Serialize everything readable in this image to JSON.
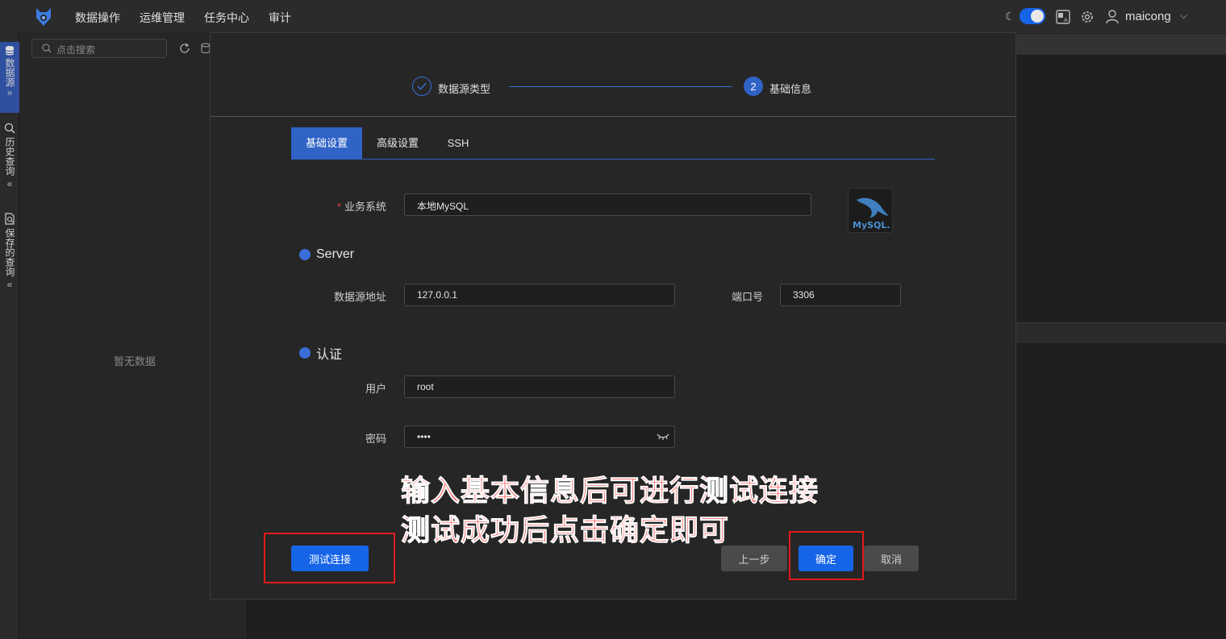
{
  "topbar": {
    "nav": [
      "数据操作",
      "运维管理",
      "任务中心",
      "审计"
    ],
    "user": "maicong"
  },
  "sidebar": {
    "sections": [
      {
        "label": "数据源",
        "icon": "database-icon"
      },
      {
        "label": "历史查询",
        "icon": "history-search-icon"
      },
      {
        "label": "保存的查询",
        "icon": "saved-query-icon"
      }
    ]
  },
  "leftpanel": {
    "search_placeholder": "点击搜索",
    "empty_text": "暂无数据"
  },
  "modal": {
    "steps": [
      {
        "label": "数据源类型",
        "state": "done"
      },
      {
        "number": "2",
        "label": "基础信息",
        "state": "active"
      }
    ],
    "tabs": [
      "基础设置",
      "高级设置",
      "SSH"
    ],
    "active_tab": "基础设置",
    "fields": {
      "business_system": {
        "label": "业务系统",
        "value": "本地MySQL",
        "required": true
      },
      "server_section": "Server",
      "host": {
        "label": "数据源地址",
        "value": "127.0.0.1"
      },
      "port": {
        "label": "端口号",
        "value": "3306"
      },
      "auth_section": "认证",
      "user": {
        "label": "用户",
        "value": "root"
      },
      "password": {
        "label": "密码",
        "value": "••••"
      }
    },
    "db_logo_text": "MySQL.",
    "buttons": {
      "test": "测试连接",
      "prev": "上一步",
      "ok": "确定",
      "cancel": "取消"
    }
  },
  "annotation": {
    "line1": "输入基本信息后可进行测试连接",
    "line2": "测试成功后点击确定即可"
  },
  "colors": {
    "accent": "#1665e8",
    "annotation": "#e01b1b"
  }
}
